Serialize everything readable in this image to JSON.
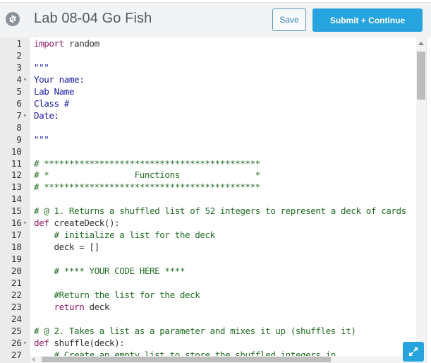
{
  "header": {
    "title": "Lab 08-04 Go Fish",
    "settings_icon": "gear-icon",
    "save_label": "Save",
    "submit_label": "Submit + Continue"
  },
  "colors": {
    "accent": "#27a3dd",
    "keyword": "#931a68",
    "comment": "#236e24",
    "string": "#1a1aa6"
  },
  "editor": {
    "expand_icon": "expand-icon",
    "lines": [
      {
        "n": "1",
        "fold": false,
        "segs": [
          {
            "t": "kw",
            "v": "import"
          },
          {
            "t": "plain",
            "v": " random"
          }
        ]
      },
      {
        "n": "2",
        "fold": false,
        "segs": []
      },
      {
        "n": "3",
        "fold": false,
        "segs": [
          {
            "t": "str",
            "v": "\"\"\""
          }
        ]
      },
      {
        "n": "4",
        "fold": true,
        "segs": [
          {
            "t": "str",
            "v": "Your name:"
          }
        ]
      },
      {
        "n": "5",
        "fold": false,
        "segs": [
          {
            "t": "str",
            "v": "Lab Name"
          }
        ]
      },
      {
        "n": "6",
        "fold": false,
        "segs": [
          {
            "t": "str",
            "v": "Class #"
          }
        ]
      },
      {
        "n": "7",
        "fold": true,
        "segs": [
          {
            "t": "str",
            "v": "Date:"
          }
        ]
      },
      {
        "n": "8",
        "fold": false,
        "segs": []
      },
      {
        "n": "9",
        "fold": false,
        "segs": [
          {
            "t": "str",
            "v": "\"\"\""
          }
        ]
      },
      {
        "n": "10",
        "fold": false,
        "segs": []
      },
      {
        "n": "11",
        "fold": false,
        "segs": [
          {
            "t": "cm",
            "v": "# *******************************************"
          }
        ]
      },
      {
        "n": "12",
        "fold": false,
        "segs": [
          {
            "t": "cm",
            "v": "# *                 Functions               *"
          }
        ]
      },
      {
        "n": "13",
        "fold": false,
        "segs": [
          {
            "t": "cm",
            "v": "# *******************************************"
          }
        ]
      },
      {
        "n": "14",
        "fold": false,
        "segs": []
      },
      {
        "n": "15",
        "fold": false,
        "segs": [
          {
            "t": "cm",
            "v": "# @ 1. Returns a shuffled list of 52 integers to represent a deck of cards"
          }
        ]
      },
      {
        "n": "16",
        "fold": true,
        "segs": [
          {
            "t": "kw",
            "v": "def"
          },
          {
            "t": "plain",
            "v": " createDeck():"
          }
        ]
      },
      {
        "n": "17",
        "fold": false,
        "segs": [
          {
            "t": "plain",
            "v": "    "
          },
          {
            "t": "cm",
            "v": "# initialize a list for the deck"
          }
        ]
      },
      {
        "n": "18",
        "fold": false,
        "segs": [
          {
            "t": "plain",
            "v": "    deck = []"
          }
        ]
      },
      {
        "n": "19",
        "fold": false,
        "segs": []
      },
      {
        "n": "20",
        "fold": false,
        "segs": [
          {
            "t": "plain",
            "v": "    "
          },
          {
            "t": "cm",
            "v": "# **** YOUR CODE HERE ****"
          }
        ]
      },
      {
        "n": "21",
        "fold": false,
        "segs": []
      },
      {
        "n": "22",
        "fold": false,
        "segs": [
          {
            "t": "plain",
            "v": "    "
          },
          {
            "t": "cm",
            "v": "#Return the list for the deck"
          }
        ]
      },
      {
        "n": "23",
        "fold": false,
        "segs": [
          {
            "t": "plain",
            "v": "    "
          },
          {
            "t": "kw",
            "v": "return"
          },
          {
            "t": "plain",
            "v": " deck"
          }
        ]
      },
      {
        "n": "24",
        "fold": false,
        "segs": []
      },
      {
        "n": "25",
        "fold": false,
        "segs": [
          {
            "t": "cm",
            "v": "# @ 2. Takes a list as a parameter and mixes it up (shuffles it)"
          }
        ]
      },
      {
        "n": "26",
        "fold": true,
        "segs": [
          {
            "t": "kw",
            "v": "def"
          },
          {
            "t": "plain",
            "v": " shuffle(deck):"
          }
        ]
      },
      {
        "n": "27",
        "fold": false,
        "segs": [
          {
            "t": "plain",
            "v": "    "
          },
          {
            "t": "cm",
            "v": "# Create an empty list to store the shuffled integers in"
          }
        ]
      }
    ]
  }
}
